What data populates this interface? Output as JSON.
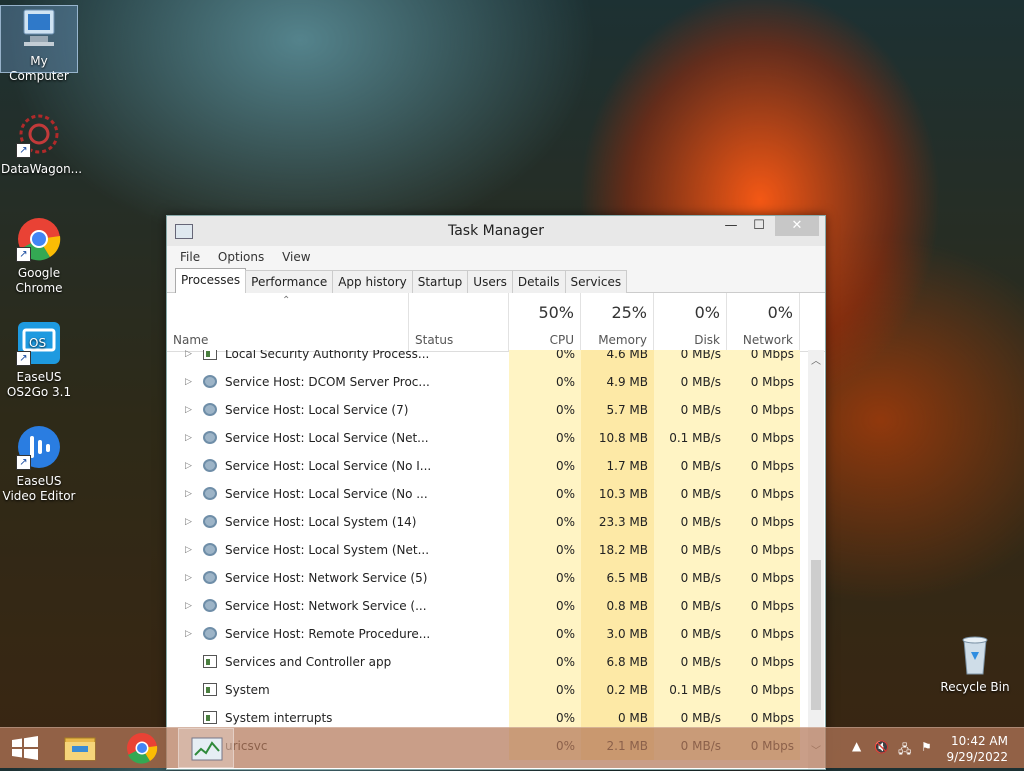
{
  "desktop": {
    "icons": [
      {
        "label": "My Computer"
      },
      {
        "label": "DataWagon..."
      },
      {
        "label": "Google Chrome"
      },
      {
        "label": "EaseUS OS2Go 3.1"
      },
      {
        "label": "EaseUS Video Editor"
      },
      {
        "label": "Recycle Bin"
      }
    ]
  },
  "window": {
    "title": "Task Manager",
    "menu": [
      "File",
      "Options",
      "View"
    ],
    "tabs": [
      "Processes",
      "Performance",
      "App history",
      "Startup",
      "Users",
      "Details",
      "Services"
    ],
    "active_tab": "Processes",
    "columns": {
      "name": "Name",
      "status": "Status",
      "cpu": {
        "pct": "50%",
        "label": "CPU"
      },
      "memory": {
        "pct": "25%",
        "label": "Memory"
      },
      "disk": {
        "pct": "0%",
        "label": "Disk"
      },
      "network": {
        "pct": "0%",
        "label": "Network"
      }
    },
    "rows": [
      {
        "name": "Local Security Authority Process...",
        "cpu": "0%",
        "memory": "4.6 MB",
        "disk": "0 MB/s",
        "network": "0 Mbps",
        "expandable": true,
        "icon": "app-window-icon"
      },
      {
        "name": "Service Host: DCOM Server Proc...",
        "cpu": "0%",
        "memory": "4.9 MB",
        "disk": "0 MB/s",
        "network": "0 Mbps",
        "expandable": true,
        "icon": "gear-icon"
      },
      {
        "name": "Service Host: Local Service (7)",
        "cpu": "0%",
        "memory": "5.7 MB",
        "disk": "0 MB/s",
        "network": "0 Mbps",
        "expandable": true,
        "icon": "gear-icon"
      },
      {
        "name": "Service Host: Local Service (Net...",
        "cpu": "0%",
        "memory": "10.8 MB",
        "disk": "0.1 MB/s",
        "network": "0 Mbps",
        "expandable": true,
        "icon": "gear-icon"
      },
      {
        "name": "Service Host: Local Service (No I...",
        "cpu": "0%",
        "memory": "1.7 MB",
        "disk": "0 MB/s",
        "network": "0 Mbps",
        "expandable": true,
        "icon": "gear-icon"
      },
      {
        "name": "Service Host: Local Service (No ...",
        "cpu": "0%",
        "memory": "10.3 MB",
        "disk": "0 MB/s",
        "network": "0 Mbps",
        "expandable": true,
        "icon": "gear-icon"
      },
      {
        "name": "Service Host: Local System (14)",
        "cpu": "0%",
        "memory": "23.3 MB",
        "disk": "0 MB/s",
        "network": "0 Mbps",
        "expandable": true,
        "icon": "gear-icon"
      },
      {
        "name": "Service Host: Local System (Net...",
        "cpu": "0%",
        "memory": "18.2 MB",
        "disk": "0 MB/s",
        "network": "0 Mbps",
        "expandable": true,
        "icon": "gear-icon"
      },
      {
        "name": "Service Host: Network Service (5)",
        "cpu": "0%",
        "memory": "6.5 MB",
        "disk": "0 MB/s",
        "network": "0 Mbps",
        "expandable": true,
        "icon": "gear-icon"
      },
      {
        "name": "Service Host: Network Service (...",
        "cpu": "0%",
        "memory": "0.8 MB",
        "disk": "0 MB/s",
        "network": "0 Mbps",
        "expandable": true,
        "icon": "gear-icon"
      },
      {
        "name": "Service Host: Remote Procedure...",
        "cpu": "0%",
        "memory": "3.0 MB",
        "disk": "0 MB/s",
        "network": "0 Mbps",
        "expandable": true,
        "icon": "gear-icon"
      },
      {
        "name": "Services and Controller app",
        "cpu": "0%",
        "memory": "6.8 MB",
        "disk": "0 MB/s",
        "network": "0 Mbps",
        "expandable": false,
        "icon": "app-window-icon"
      },
      {
        "name": "System",
        "cpu": "0%",
        "memory": "0.2 MB",
        "disk": "0.1 MB/s",
        "network": "0 Mbps",
        "expandable": false,
        "icon": "app-window-icon"
      },
      {
        "name": "System interrupts",
        "cpu": "0%",
        "memory": "0 MB",
        "disk": "0 MB/s",
        "network": "0 Mbps",
        "expandable": false,
        "icon": "app-window-icon"
      },
      {
        "name": "uricsvc",
        "cpu": "0%",
        "memory": "2.1 MB",
        "disk": "0 MB/s",
        "network": "0 Mbps",
        "expandable": false,
        "icon": "app-window-icon"
      }
    ]
  },
  "taskbar": {
    "clock_time": "10:42 AM",
    "clock_date": "9/29/2022"
  }
}
